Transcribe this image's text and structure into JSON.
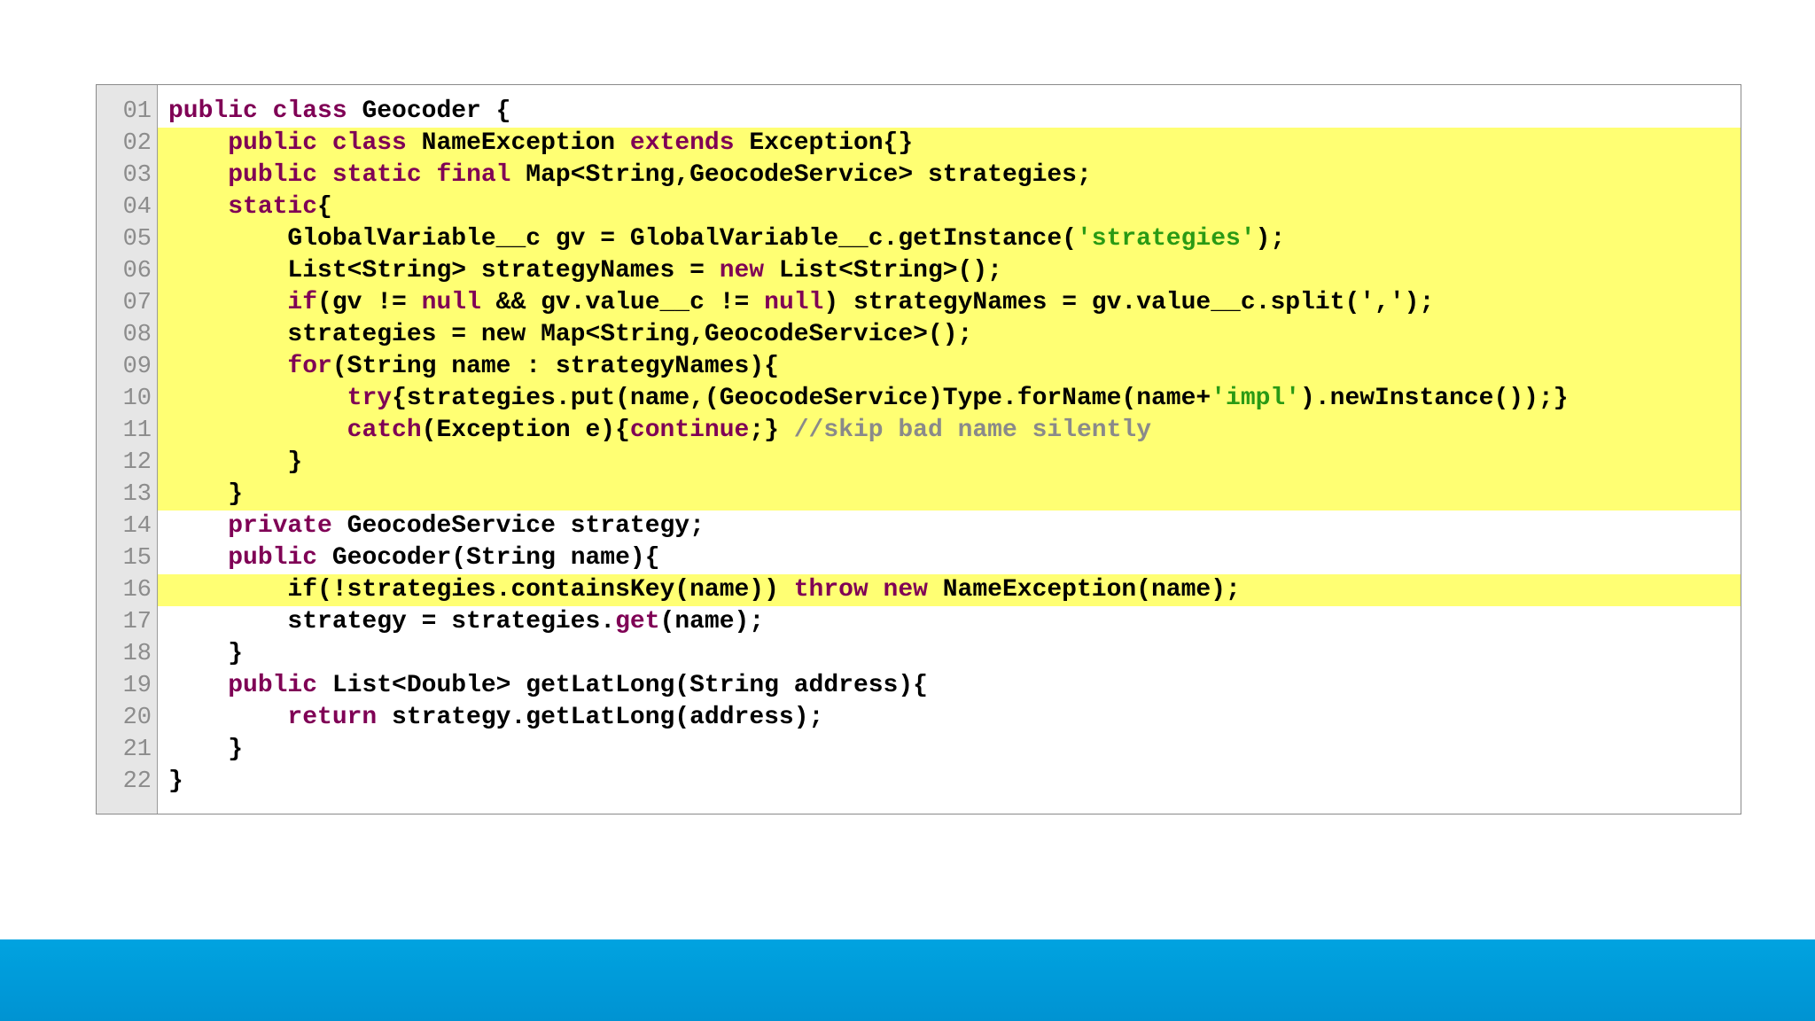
{
  "code_panel": {
    "lines": [
      {
        "num": "01",
        "hl": false,
        "tokens": [
          {
            "t": "kw",
            "v": "public class "
          },
          {
            "t": "pl",
            "v": "Geocoder {"
          }
        ]
      },
      {
        "num": "02",
        "hl": true,
        "tokens": [
          {
            "t": "pl",
            "v": "    "
          },
          {
            "t": "kw",
            "v": "public class "
          },
          {
            "t": "pl",
            "v": "NameException "
          },
          {
            "t": "kw",
            "v": "extends "
          },
          {
            "t": "pl",
            "v": "Exception{}"
          }
        ]
      },
      {
        "num": "03",
        "hl": true,
        "tokens": [
          {
            "t": "pl",
            "v": "    "
          },
          {
            "t": "kw",
            "v": "public static final "
          },
          {
            "t": "pl",
            "v": "Map<String,GeocodeService> strategies;"
          }
        ]
      },
      {
        "num": "04",
        "hl": true,
        "tokens": [
          {
            "t": "pl",
            "v": "    "
          },
          {
            "t": "kw",
            "v": "static"
          },
          {
            "t": "pl",
            "v": "{"
          }
        ]
      },
      {
        "num": "05",
        "hl": true,
        "tokens": [
          {
            "t": "pl",
            "v": "        GlobalVariable__c gv = GlobalVariable__c.getInstance("
          },
          {
            "t": "str",
            "v": "'strategies'"
          },
          {
            "t": "pl",
            "v": ");"
          }
        ]
      },
      {
        "num": "06",
        "hl": true,
        "tokens": [
          {
            "t": "pl",
            "v": "        List<String> strategyNames = "
          },
          {
            "t": "kw",
            "v": "new "
          },
          {
            "t": "pl",
            "v": "List<String>();"
          }
        ]
      },
      {
        "num": "07",
        "hl": true,
        "tokens": [
          {
            "t": "pl",
            "v": "        "
          },
          {
            "t": "kw",
            "v": "if"
          },
          {
            "t": "pl",
            "v": "(gv != "
          },
          {
            "t": "kw",
            "v": "null"
          },
          {
            "t": "pl",
            "v": " && gv.value__c != "
          },
          {
            "t": "kw",
            "v": "null"
          },
          {
            "t": "pl",
            "v": ") strategyNames = gv.value__c.split(',');"
          }
        ]
      },
      {
        "num": "08",
        "hl": true,
        "tokens": [
          {
            "t": "pl",
            "v": "        strategies = new Map<String,GeocodeService>();"
          }
        ]
      },
      {
        "num": "09",
        "hl": true,
        "tokens": [
          {
            "t": "pl",
            "v": "        "
          },
          {
            "t": "kw",
            "v": "for"
          },
          {
            "t": "pl",
            "v": "(String name : strategyNames){"
          }
        ]
      },
      {
        "num": "10",
        "hl": true,
        "tokens": [
          {
            "t": "pl",
            "v": "            "
          },
          {
            "t": "kw",
            "v": "try"
          },
          {
            "t": "pl",
            "v": "{strategies.put(name,(GeocodeService)Type.forName(name+"
          },
          {
            "t": "str",
            "v": "'impl'"
          },
          {
            "t": "pl",
            "v": ").newInstance());}"
          }
        ]
      },
      {
        "num": "11",
        "hl": true,
        "tokens": [
          {
            "t": "pl",
            "v": "            "
          },
          {
            "t": "kw",
            "v": "catch"
          },
          {
            "t": "pl",
            "v": "(Exception e){"
          },
          {
            "t": "kw",
            "v": "continue"
          },
          {
            "t": "pl",
            "v": ";} "
          },
          {
            "t": "cm",
            "v": "//skip bad name silently"
          }
        ]
      },
      {
        "num": "12",
        "hl": true,
        "tokens": [
          {
            "t": "pl",
            "v": "        }"
          }
        ]
      },
      {
        "num": "13",
        "hl": true,
        "tokens": [
          {
            "t": "pl",
            "v": "    }"
          }
        ]
      },
      {
        "num": "14",
        "hl": false,
        "tokens": [
          {
            "t": "pl",
            "v": "    "
          },
          {
            "t": "kw",
            "v": "private "
          },
          {
            "t": "pl",
            "v": "GeocodeService strategy;"
          }
        ]
      },
      {
        "num": "15",
        "hl": false,
        "tokens": [
          {
            "t": "pl",
            "v": "    "
          },
          {
            "t": "kw",
            "v": "public "
          },
          {
            "t": "pl",
            "v": "Geocoder(String name){"
          }
        ]
      },
      {
        "num": "16",
        "hl": true,
        "tokens": [
          {
            "t": "pl",
            "v": "        if(!strategies.containsKey(name)) "
          },
          {
            "t": "kw",
            "v": "throw new "
          },
          {
            "t": "pl",
            "v": "NameException(name);"
          }
        ]
      },
      {
        "num": "17",
        "hl": false,
        "tokens": [
          {
            "t": "pl",
            "v": "        strategy = strategies."
          },
          {
            "t": "kw",
            "v": "get"
          },
          {
            "t": "pl",
            "v": "(name);"
          }
        ]
      },
      {
        "num": "18",
        "hl": false,
        "tokens": [
          {
            "t": "pl",
            "v": "    }"
          }
        ]
      },
      {
        "num": "19",
        "hl": false,
        "tokens": [
          {
            "t": "pl",
            "v": "    "
          },
          {
            "t": "kw",
            "v": "public "
          },
          {
            "t": "pl",
            "v": "List<Double> getLatLong(String address){"
          }
        ]
      },
      {
        "num": "20",
        "hl": false,
        "tokens": [
          {
            "t": "pl",
            "v": "        "
          },
          {
            "t": "kw",
            "v": "return "
          },
          {
            "t": "pl",
            "v": "strategy.getLatLong(address);"
          }
        ]
      },
      {
        "num": "21",
        "hl": false,
        "tokens": [
          {
            "t": "pl",
            "v": "    }"
          }
        ]
      },
      {
        "num": "22",
        "hl": false,
        "tokens": [
          {
            "t": "pl",
            "v": "}"
          }
        ]
      }
    ]
  },
  "colors": {
    "keyword": "#7f0055",
    "string": "#2a9a14",
    "comment": "#8a8a8a",
    "highlight": "#ffff73",
    "footer": "#01a3e0"
  }
}
